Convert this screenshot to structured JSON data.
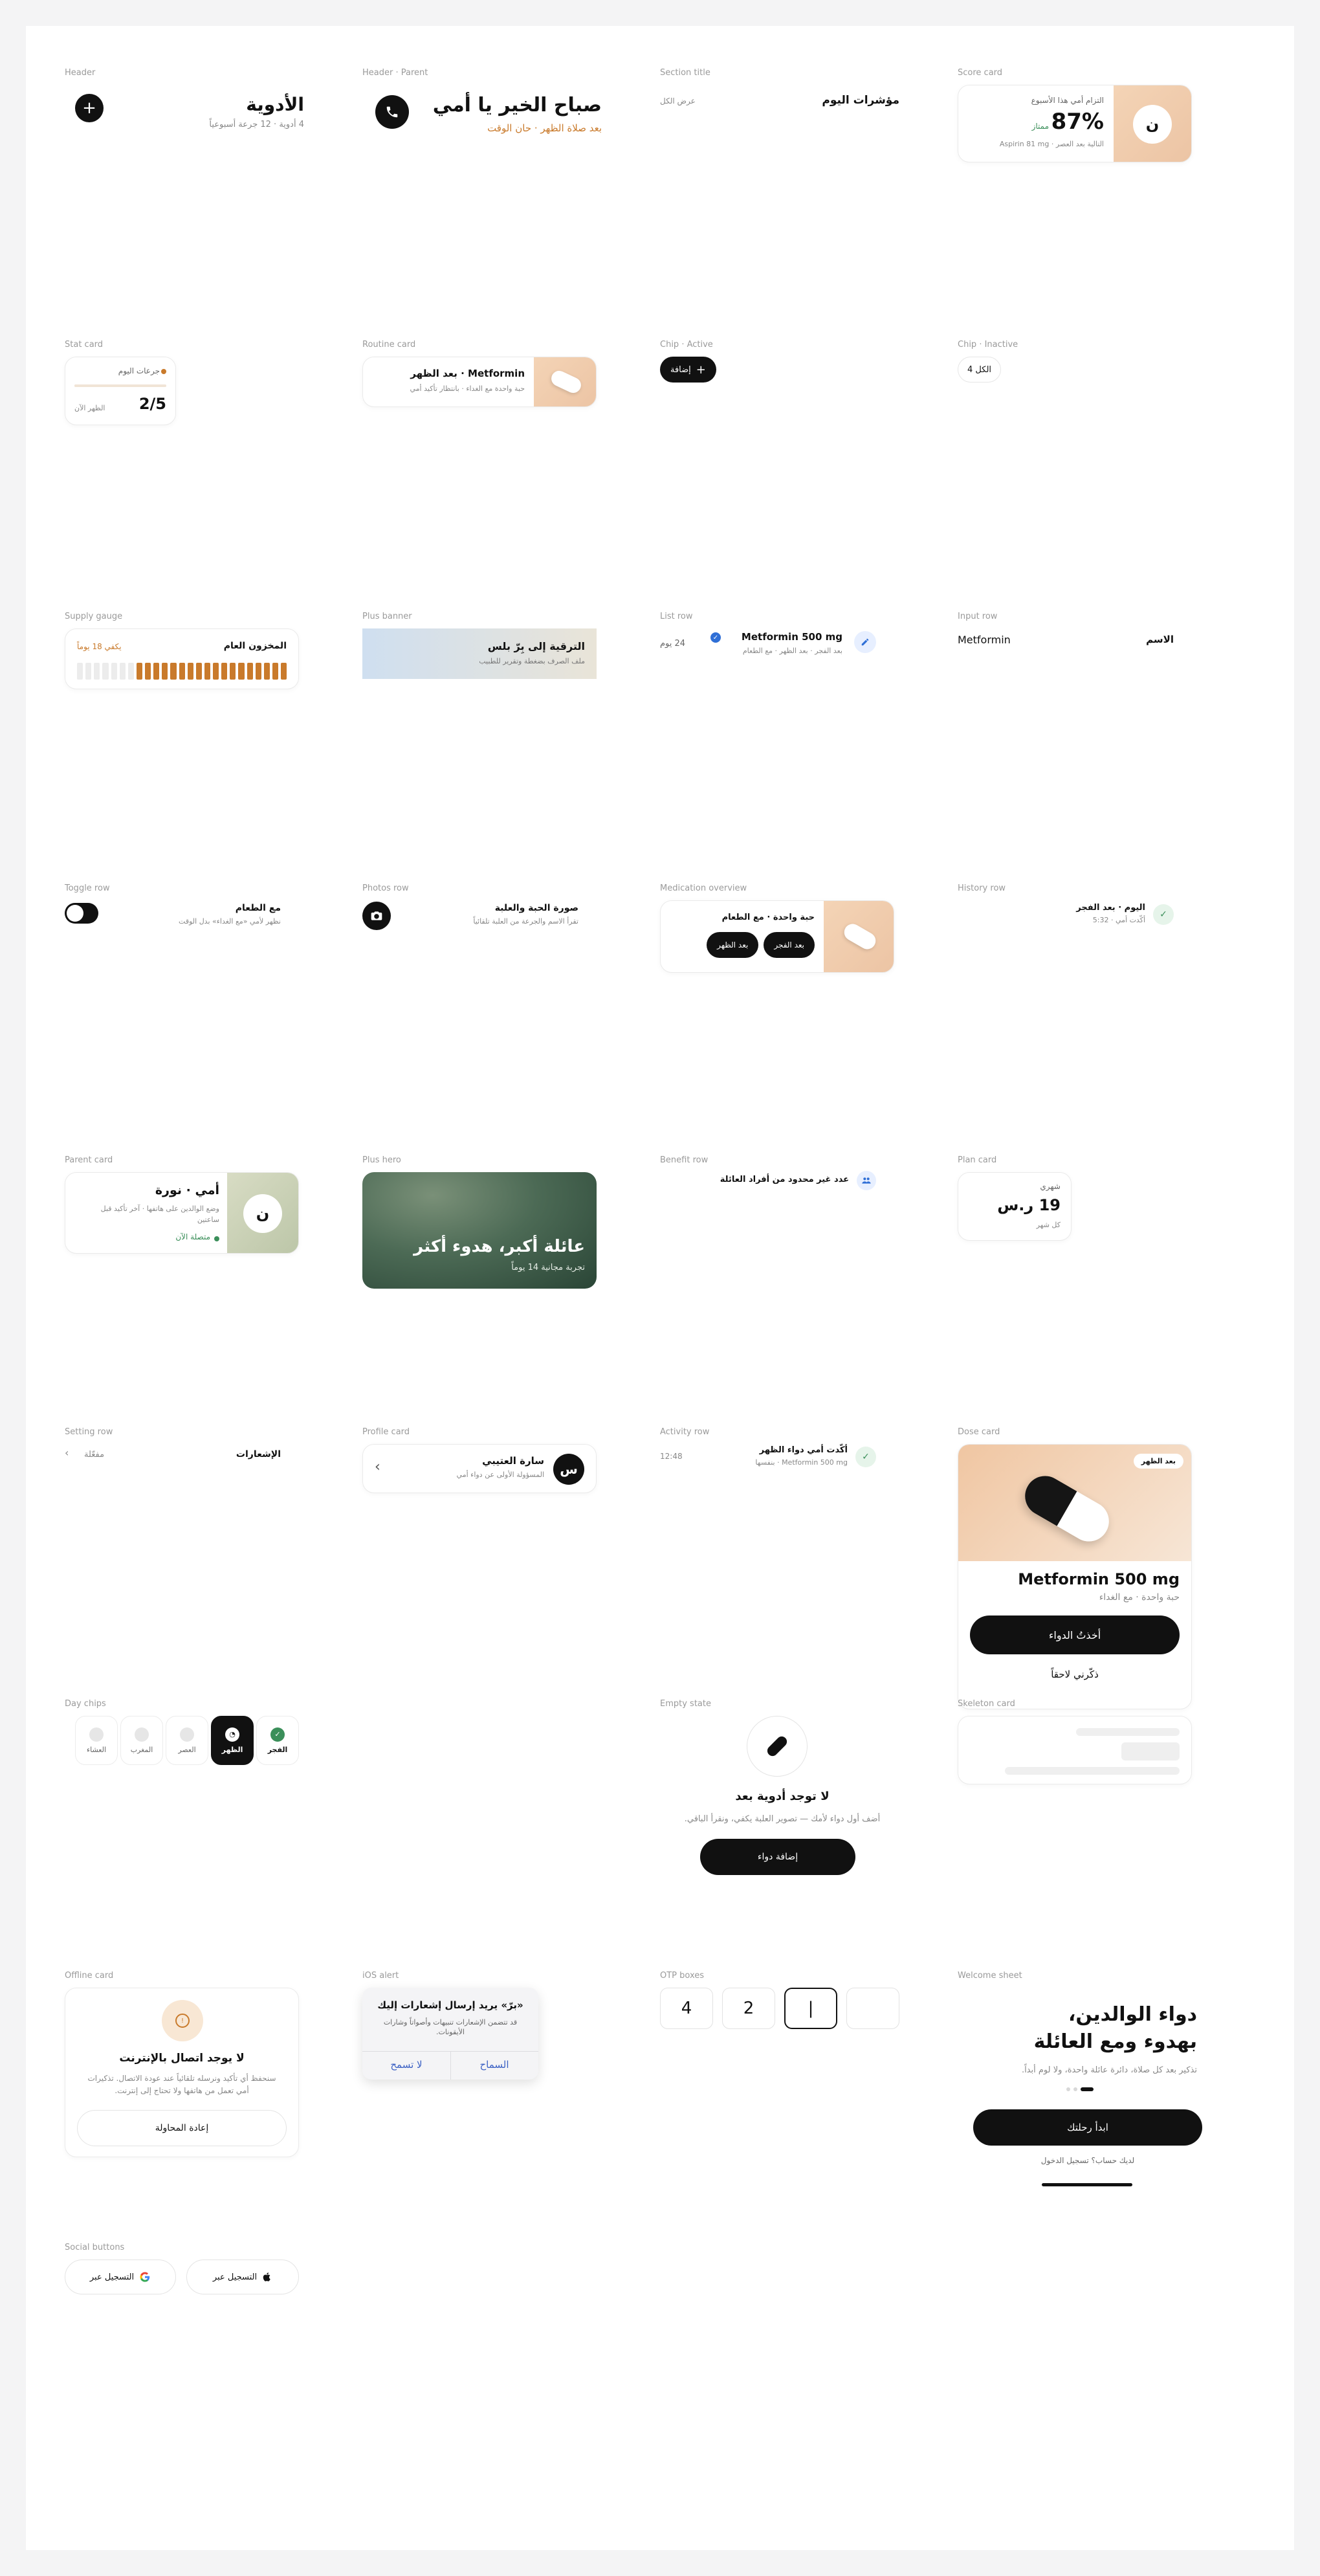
{
  "labels": {
    "header": "Header",
    "header_parent": "Header · Parent",
    "section_title": "Section title",
    "score_card": "Score card",
    "stat_card": "Stat card",
    "routine_card": "Routine card",
    "chip_active": "Chip · Active",
    "chip_inactive": "Chip · Inactive",
    "supply_gauge": "Supply gauge",
    "plus_banner": "Plus banner",
    "list_row": "List row",
    "input_row": "Input row",
    "toggle_row": "Toggle row",
    "photos_row": "Photos row",
    "medication_overview": "Medication overview",
    "history_row": "History row",
    "parent_card": "Parent card",
    "plus_hero": "Plus hero",
    "benefit_row": "Benefit row",
    "plan_card": "Plan card",
    "setting_row": "Setting row",
    "profile_card": "Profile card",
    "activity_row": "Activity row",
    "dose_card": "Dose card",
    "day_chips": "Day chips",
    "empty_state": "Empty state",
    "skeleton_card": "Skeleton card",
    "offline_card": "Offline card",
    "ios_alert": "iOS alert",
    "otp_boxes": "OTP boxes",
    "welcome_sheet": "Welcome sheet",
    "social_buttons": "Social buttons"
  },
  "header": {
    "title": "الأدوية",
    "subtitle": "4 أدوية · 12 جرعة أسبوعياً",
    "add_icon": "plus-icon"
  },
  "header_parent": {
    "title": "صباح الخير يا أمي",
    "subtitle": "بعد صلاة الظهر · حان الوقت",
    "call_icon": "phone-icon"
  },
  "section_title": {
    "title": "مؤشرات اليوم",
    "link": "عرض الكل"
  },
  "score_card": {
    "caption": "التزام أمي هذا الأسبوع",
    "value": "87%",
    "rating": "ممتاز",
    "next": "التالية بعد العصر · Aspirin 81 mg",
    "avatar": "ن"
  },
  "stat_card": {
    "label": "جرعات اليوم",
    "value": "2/5",
    "sub": "الظهر الآن",
    "progress": 0.4
  },
  "routine_card": {
    "title": "Metformin · بعد الظهر",
    "sub": "حبة واحدة مع الغداء · بانتظار تأكيد أمي"
  },
  "chip_active": {
    "label": "إضافة"
  },
  "chip_inactive": {
    "label": "الكل 4"
  },
  "supply_gauge": {
    "title": "المخزون العام",
    "note": "يكفي 18 يوماً",
    "filled": 18,
    "total": 25
  },
  "plus_banner": {
    "title": "الترقية إلى بِرّ بلس",
    "sub": "ملف الصرف بضغطة وتقرير للطبيب"
  },
  "list_row": {
    "title": "Metformin 500 mg",
    "sub": "بعد الفجر · بعد الظهر · مع الطعام",
    "days": "24 يوم"
  },
  "input_row": {
    "label": "الاسم",
    "value": "Metformin"
  },
  "toggle_row": {
    "title": "مع الطعام",
    "sub": "نظهر لأمي «مع الغداء» بدل الوقت",
    "on": false
  },
  "photos_row": {
    "title": "صورة الحبة والعلبة",
    "sub": "تقرأ الاسم والجرعة من العلبة تلقائياً"
  },
  "medication_overview": {
    "title": "حبة واحدة · مع الطعام",
    "chips": [
      "بعد الفجر",
      "بعد الظهر"
    ]
  },
  "history_row": {
    "title": "اليوم · بعد الفجر",
    "sub": "أكّدت أمي · 5:32"
  },
  "parent_card": {
    "title": "أمي · نورة",
    "sub": "وضع الوالدين على هاتفها · آخر تأكيد قبل ساعتين",
    "status": "متصلة الآن",
    "avatar": "ن"
  },
  "plus_hero": {
    "title": "عائلة أكبر، هدوء أكثر",
    "sub": "تجربة مجانية 14 يوماً"
  },
  "benefit_row": {
    "text": "عدد غير محدود من أفراد العائلة"
  },
  "plan_card": {
    "period": "شهري",
    "price": "19 ر.س",
    "note": "كل شهر"
  },
  "setting_row": {
    "title": "الإشعارات",
    "value": "مفعّلة"
  },
  "profile_card": {
    "name": "سارة العتيبي",
    "sub": "المسؤولة الأولى عن دواء أمي",
    "avatar": "س"
  },
  "activity_row": {
    "title": "أكّدت أمي دواء الظهر",
    "sub": "Metformin 500 mg · بنفسها",
    "time": "12:48"
  },
  "dose_card": {
    "badge": "بعد الظهر",
    "title": "Metformin 500 mg",
    "sub": "حبة واحدة · مع الغداء",
    "primary": "أخذتُ الدواء",
    "secondary": "ذكّرني لاحقاً"
  },
  "day_chips": [
    {
      "label": "الفجر",
      "state": "done"
    },
    {
      "label": "الظهر",
      "state": "active"
    },
    {
      "label": "العصر",
      "state": "pending"
    },
    {
      "label": "المغرب",
      "state": "pending"
    },
    {
      "label": "العشاء",
      "state": "pending"
    }
  ],
  "empty_state": {
    "title": "لا توجد أدوية بعد",
    "sub": "أضف أول دواء لأمك — تصوير العلبة يكفي، ونقرأ الباقي.",
    "button": "إضافة دواء"
  },
  "offline_card": {
    "title": "لا يوجد اتصال بالإنترنت",
    "sub": "سنحفظ أي تأكيد ونرسله تلقائياً عند عودة الاتصال. تذكيرات أمي تعمل من هاتفها ولا تحتاج إلى إنترنت.",
    "button": "إعادة المحاولة"
  },
  "ios_alert": {
    "title": "«برّ» يريد إرسال إشعارات إليك",
    "sub": "قد تتضمن الإشعارات تنبيهات وأصواتاً وشارات الأيقونات.",
    "deny": "لا تسمح",
    "allow": "السماح"
  },
  "otp": {
    "digits": [
      "4",
      "2",
      "|",
      ""
    ]
  },
  "welcome_sheet": {
    "title_line1": "دواء الوالدين،",
    "title_line2": "بهدوء ومع العائلة",
    "sub": "تذكير بعد كل صلاة، دائرة عائلة واحدة، ولا لوم أبداً.",
    "button": "ابدأ رحلتك",
    "login": "لديك حساب؟ تسجيل الدخول"
  },
  "social": {
    "apple": "التسجيل عبر",
    "google": "التسجيل عبر"
  },
  "colors": {
    "accent": "#c97a2b",
    "green": "#3b8f5a",
    "blue": "#2f6fd6",
    "dark": "#111111"
  }
}
